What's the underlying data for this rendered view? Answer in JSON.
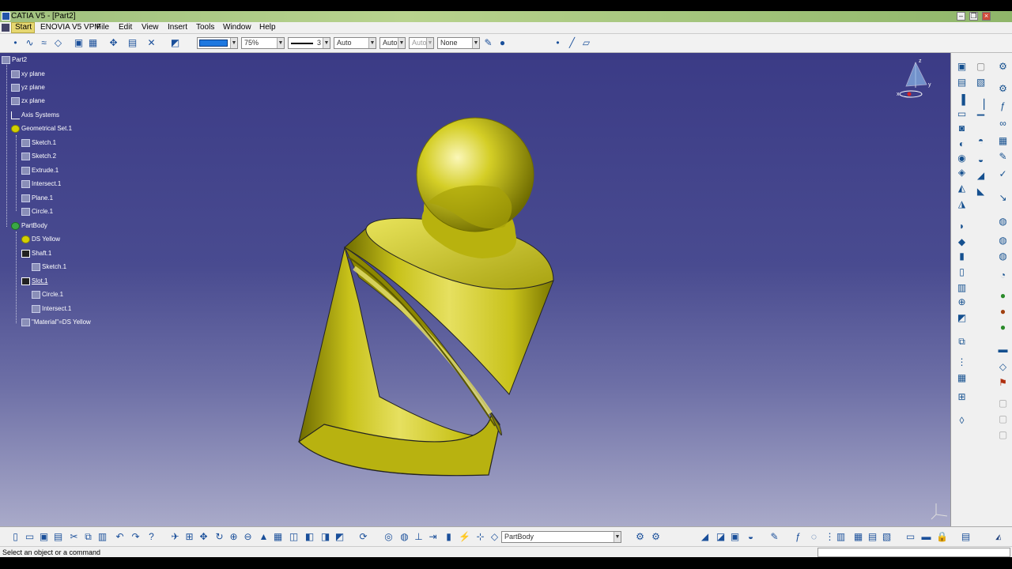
{
  "window": {
    "title": "CATIA V5 - [Part2]",
    "minimize": "–",
    "restore": "❐",
    "close": "×"
  },
  "menu": {
    "items": [
      "Start",
      "ENOVIA V5 VPM",
      "File",
      "Edit",
      "View",
      "Insert",
      "Tools",
      "Window",
      "Help"
    ]
  },
  "properties": {
    "color_hex": "#1e78e0",
    "transparency": "75%",
    "line_weight": "3",
    "line_type": "Auto",
    "point_symbol": "Auto",
    "layer_auto": "Auto",
    "layer": "None"
  },
  "tree": {
    "nodes": [
      {
        "label": "Part2"
      },
      {
        "label": "xy plane"
      },
      {
        "label": "yz plane"
      },
      {
        "label": "zx plane"
      },
      {
        "label": "Axis Systems"
      },
      {
        "label": "Geometrical Set.1"
      },
      {
        "label": "Sketch.1"
      },
      {
        "label": "Sketch.2"
      },
      {
        "label": "Extrude.1"
      },
      {
        "label": "Intersect.1"
      },
      {
        "label": "Plane.1"
      },
      {
        "label": "Circle.1"
      },
      {
        "label": "PartBody"
      },
      {
        "label": "DS Yellow"
      },
      {
        "label": "Shaft.1"
      },
      {
        "label": "Sketch.1"
      },
      {
        "label": "Slot.1"
      },
      {
        "label": "Circle.1"
      },
      {
        "label": "Intersect.1"
      },
      {
        "label": "\"Material\"=DS Yellow"
      }
    ]
  },
  "compass": {
    "x": "x",
    "y": "y",
    "z": "z"
  },
  "bottom": {
    "current_body": "PartBody"
  },
  "status": {
    "message": "Select an object or a command"
  },
  "colors": {
    "part": "#c8c21a",
    "part_dark": "#6e6b00",
    "part_light": "#f4f0a0",
    "background_top": "#3b3b86",
    "background_bottom": "#a9aac9"
  }
}
